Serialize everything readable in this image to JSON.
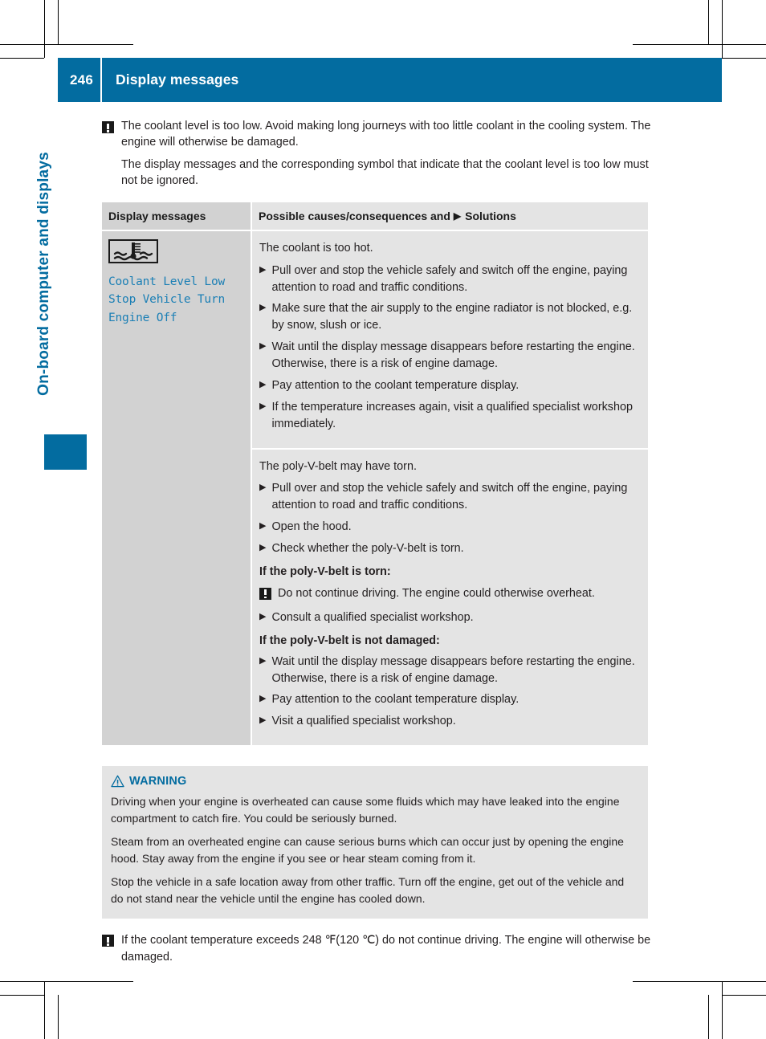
{
  "header": {
    "page_number": "246",
    "title": "Display messages",
    "accent_color": "#036ca0"
  },
  "side_tab": {
    "label": "On-board computer and displays"
  },
  "intro": {
    "warning_note": "The coolant level is too low. Avoid making long journeys with too little coolant in the cooling system. The engine will otherwise be damaged.",
    "paragraph": "The display messages and the corresponding symbol that indicate that the coolant level is too low must not be ignored."
  },
  "table": {
    "headers": {
      "left": "Display messages",
      "right_prefix": "Possible causes/consequences and",
      "right_suffix": "Solutions",
      "triangle": "▶"
    },
    "display_message": {
      "icon_name": "coolant-temperature-warning-icon",
      "lines": [
        "Coolant Level Low",
        "Stop Vehicle Turn",
        "Engine Off"
      ],
      "text_color": "#1b7fb5"
    },
    "rows": [
      {
        "lead": "The coolant is too hot.",
        "steps": [
          "Pull over and stop the vehicle safely and switch off the engine, paying attention to road and traffic conditions.",
          "Make sure that the air supply to the engine radiator is not blocked, e.g. by snow, slush or ice.",
          "Wait until the display message disappears before restarting the engine. Otherwise, there is a risk of engine damage.",
          "Pay attention to the coolant temperature display.",
          "If the temperature increases again, visit a qualified specialist workshop immediately."
        ]
      },
      {
        "lead": "The poly-V-belt may have torn.",
        "steps": [
          "Pull over and stop the vehicle safely and switch off the engine, paying attention to road and traffic conditions.",
          "Open the hood.",
          "Check whether the poly-V-belt is torn."
        ],
        "subhead_torn": "If the poly-V-belt is torn:",
        "note_torn": "Do not continue driving. The engine could otherwise overheat.",
        "steps_torn": [
          "Consult a qualified specialist workshop."
        ],
        "subhead_not_damaged": "If the poly-V-belt is not damaged:",
        "steps_not_damaged": [
          "Wait until the display message disappears before restarting the engine. Otherwise, there is a risk of engine damage.",
          "Pay attention to the coolant temperature display.",
          "Visit a qualified specialist workshop."
        ]
      }
    ]
  },
  "warning_box": {
    "title": "WARNING",
    "icon_name": "warning-triangle-icon",
    "paragraphs": [
      "Driving when your engine is overheated can cause some fluids which may have leaked into the engine compartment to catch fire. You could be seriously burned.",
      "Steam from an overheated engine can cause serious burns which can occur just by opening the engine hood. Stay away from the engine if you see or hear steam coming from it.",
      "Stop the vehicle in a safe location away from other traffic. Turn off the engine, get out of the vehicle and do not stand near the vehicle until the engine has cooled down."
    ]
  },
  "footer_note": {
    "text": "If the coolant temperature exceeds 248 ℉(120 ℃) do not continue driving. The engine will otherwise be damaged."
  }
}
